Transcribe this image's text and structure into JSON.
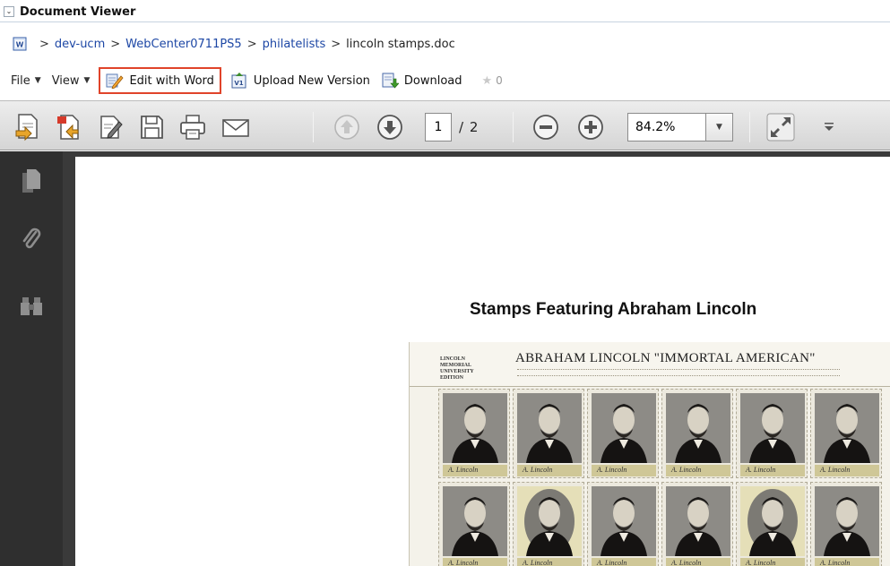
{
  "header": {
    "title": "Document Viewer",
    "collapse_glyph": "⌄"
  },
  "breadcrumb": {
    "items": [
      "dev-ucm",
      "WebCenter0711PS5",
      "philatelists"
    ],
    "current": "lincoln stamps.doc",
    "separator": ">"
  },
  "menu": {
    "file_label": "File",
    "view_label": "View",
    "edit_label": "Edit with Word",
    "upload_label": "Upload New Version",
    "download_label": "Download",
    "rating_count": "0"
  },
  "toolbar": {
    "page_current": "1",
    "page_total": "/ 2",
    "zoom_value": "84.2%"
  },
  "document": {
    "heading": "Stamps Featuring Abraham Lincoln",
    "sheet_title": "ABRAHAM LINCOLN \"IMMORTAL AMERICAN\"",
    "sheet_left_text": "LINCOLN MEMORIAL UNIVERSITY EDITION",
    "signature": "A. Lincoln"
  },
  "colors": {
    "link": "#1d47a5",
    "highlight_border": "#e0442a",
    "sidebar_bg": "#2f2f2f",
    "viewport_bg": "#3a3a3a"
  },
  "icons": [
    "word-doc-icon",
    "edit-word-icon",
    "upload-version-icon",
    "download-icon",
    "star-icon",
    "create-pdf-icon",
    "export-icon",
    "sign-icon",
    "save-icon",
    "print-icon",
    "email-icon",
    "page-up-icon",
    "page-down-icon",
    "zoom-out-icon",
    "zoom-in-icon",
    "fullscreen-icon",
    "pages-icon",
    "attachment-icon",
    "search-icon"
  ]
}
